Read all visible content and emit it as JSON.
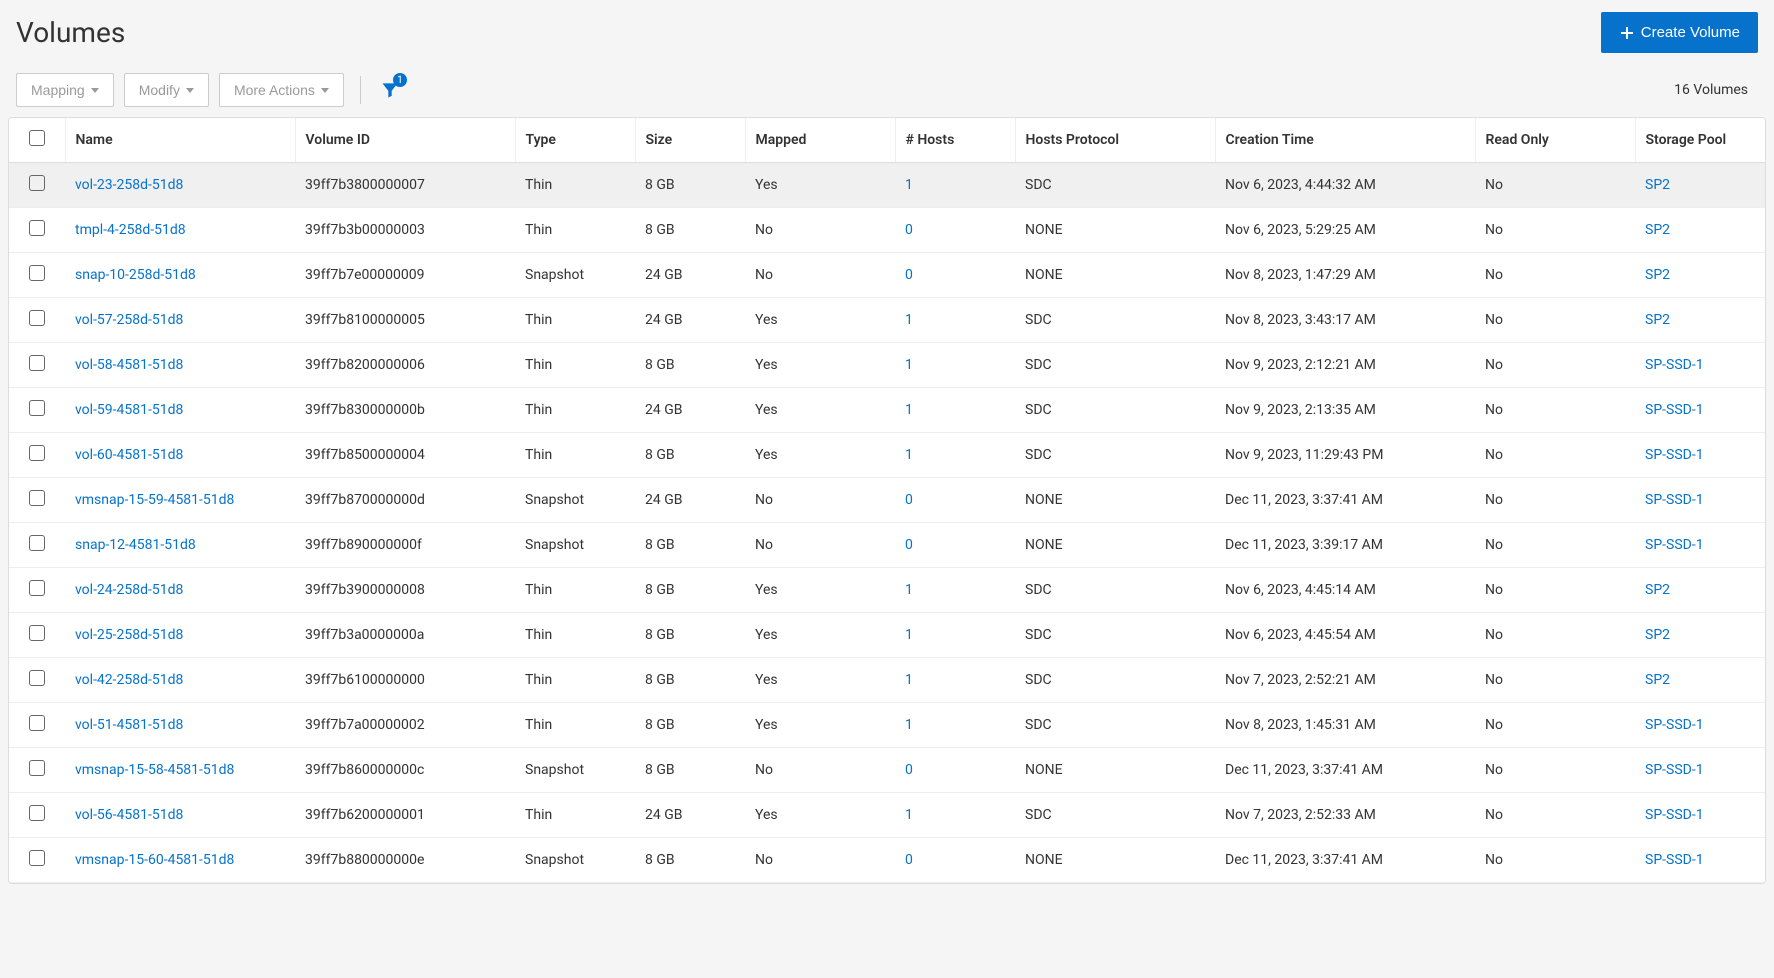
{
  "page_title": "Volumes",
  "create_button": "Create Volume",
  "toolbar": {
    "mapping": "Mapping",
    "modify": "Modify",
    "more_actions": "More Actions"
  },
  "filter_badge": "1",
  "count_text": "16 Volumes",
  "columns": {
    "name": "Name",
    "volume_id": "Volume ID",
    "type": "Type",
    "size": "Size",
    "mapped": "Mapped",
    "hosts": "# Hosts",
    "protocol": "Hosts Protocol",
    "creation": "Creation Time",
    "read_only": "Read Only",
    "pool": "Storage Pool"
  },
  "rows": [
    {
      "name": "vol-23-258d-51d8",
      "id": "39ff7b3800000007",
      "type": "Thin",
      "size": "8 GB",
      "mapped": "Yes",
      "hosts": "1",
      "protocol": "SDC",
      "time": "Nov 6, 2023, 4:44:32 AM",
      "ro": "No",
      "pool": "SP2"
    },
    {
      "name": "tmpl-4-258d-51d8",
      "id": "39ff7b3b00000003",
      "type": "Thin",
      "size": "8 GB",
      "mapped": "No",
      "hosts": "0",
      "protocol": "NONE",
      "time": "Nov 6, 2023, 5:29:25 AM",
      "ro": "No",
      "pool": "SP2"
    },
    {
      "name": "snap-10-258d-51d8",
      "id": "39ff7b7e00000009",
      "type": "Snapshot",
      "size": "24 GB",
      "mapped": "No",
      "hosts": "0",
      "protocol": "NONE",
      "time": "Nov 8, 2023, 1:47:29 AM",
      "ro": "No",
      "pool": "SP2"
    },
    {
      "name": "vol-57-258d-51d8",
      "id": "39ff7b8100000005",
      "type": "Thin",
      "size": "24 GB",
      "mapped": "Yes",
      "hosts": "1",
      "protocol": "SDC",
      "time": "Nov 8, 2023, 3:43:17 AM",
      "ro": "No",
      "pool": "SP2"
    },
    {
      "name": "vol-58-4581-51d8",
      "id": "39ff7b8200000006",
      "type": "Thin",
      "size": "8 GB",
      "mapped": "Yes",
      "hosts": "1",
      "protocol": "SDC",
      "time": "Nov 9, 2023, 2:12:21 AM",
      "ro": "No",
      "pool": "SP-SSD-1"
    },
    {
      "name": "vol-59-4581-51d8",
      "id": "39ff7b830000000b",
      "type": "Thin",
      "size": "24 GB",
      "mapped": "Yes",
      "hosts": "1",
      "protocol": "SDC",
      "time": "Nov 9, 2023, 2:13:35 AM",
      "ro": "No",
      "pool": "SP-SSD-1"
    },
    {
      "name": "vol-60-4581-51d8",
      "id": "39ff7b8500000004",
      "type": "Thin",
      "size": "8 GB",
      "mapped": "Yes",
      "hosts": "1",
      "protocol": "SDC",
      "time": "Nov 9, 2023, 11:29:43 PM",
      "ro": "No",
      "pool": "SP-SSD-1"
    },
    {
      "name": "vmsnap-15-59-4581-51d8",
      "id": "39ff7b870000000d",
      "type": "Snapshot",
      "size": "24 GB",
      "mapped": "No",
      "hosts": "0",
      "protocol": "NONE",
      "time": "Dec 11, 2023, 3:37:41 AM",
      "ro": "No",
      "pool": "SP-SSD-1"
    },
    {
      "name": "snap-12-4581-51d8",
      "id": "39ff7b890000000f",
      "type": "Snapshot",
      "size": "8 GB",
      "mapped": "No",
      "hosts": "0",
      "protocol": "NONE",
      "time": "Dec 11, 2023, 3:39:17 AM",
      "ro": "No",
      "pool": "SP-SSD-1"
    },
    {
      "name": "vol-24-258d-51d8",
      "id": "39ff7b3900000008",
      "type": "Thin",
      "size": "8 GB",
      "mapped": "Yes",
      "hosts": "1",
      "protocol": "SDC",
      "time": "Nov 6, 2023, 4:45:14 AM",
      "ro": "No",
      "pool": "SP2"
    },
    {
      "name": "vol-25-258d-51d8",
      "id": "39ff7b3a0000000a",
      "type": "Thin",
      "size": "8 GB",
      "mapped": "Yes",
      "hosts": "1",
      "protocol": "SDC",
      "time": "Nov 6, 2023, 4:45:54 AM",
      "ro": "No",
      "pool": "SP2"
    },
    {
      "name": "vol-42-258d-51d8",
      "id": "39ff7b6100000000",
      "type": "Thin",
      "size": "8 GB",
      "mapped": "Yes",
      "hosts": "1",
      "protocol": "SDC",
      "time": "Nov 7, 2023, 2:52:21 AM",
      "ro": "No",
      "pool": "SP2"
    },
    {
      "name": "vol-51-4581-51d8",
      "id": "39ff7b7a00000002",
      "type": "Thin",
      "size": "8 GB",
      "mapped": "Yes",
      "hosts": "1",
      "protocol": "SDC",
      "time": "Nov 8, 2023, 1:45:31 AM",
      "ro": "No",
      "pool": "SP-SSD-1"
    },
    {
      "name": "vmsnap-15-58-4581-51d8",
      "id": "39ff7b860000000c",
      "type": "Snapshot",
      "size": "8 GB",
      "mapped": "No",
      "hosts": "0",
      "protocol": "NONE",
      "time": "Dec 11, 2023, 3:37:41 AM",
      "ro": "No",
      "pool": "SP-SSD-1"
    },
    {
      "name": "vol-56-4581-51d8",
      "id": "39ff7b6200000001",
      "type": "Thin",
      "size": "24 GB",
      "mapped": "Yes",
      "hosts": "1",
      "protocol": "SDC",
      "time": "Nov 7, 2023, 2:52:33 AM",
      "ro": "No",
      "pool": "SP-SSD-1"
    },
    {
      "name": "vmsnap-15-60-4581-51d8",
      "id": "39ff7b880000000e",
      "type": "Snapshot",
      "size": "8 GB",
      "mapped": "No",
      "hosts": "0",
      "protocol": "NONE",
      "time": "Dec 11, 2023, 3:37:41 AM",
      "ro": "No",
      "pool": "SP-SSD-1"
    }
  ]
}
